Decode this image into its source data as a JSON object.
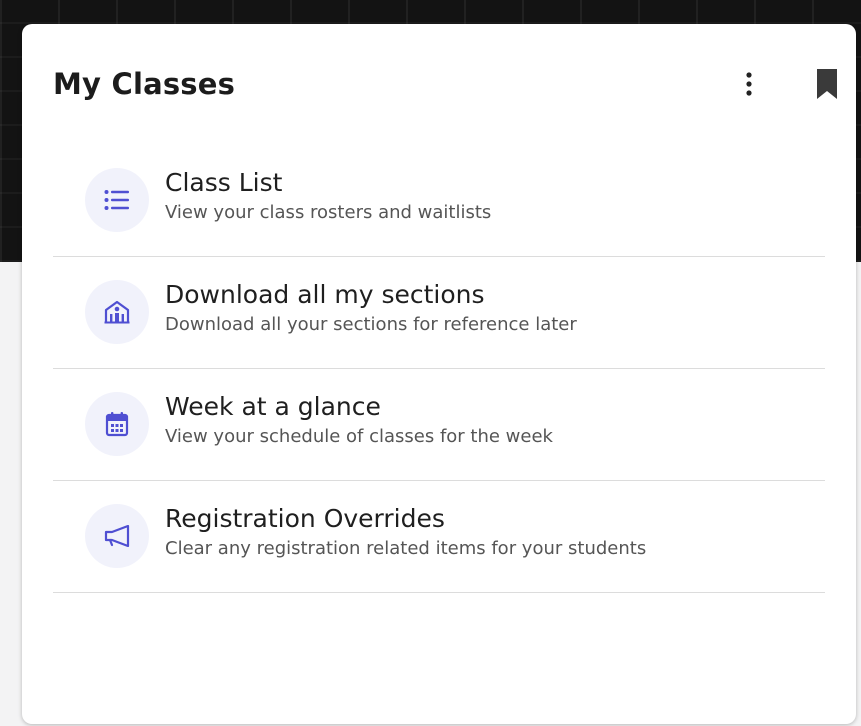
{
  "card": {
    "title": "My Classes",
    "menu_icon": "more-vertical-icon",
    "bookmark_icon": "bookmark-icon"
  },
  "items": [
    {
      "title": "Class List",
      "description": "View your class rosters and waitlists",
      "icon": "list-icon"
    },
    {
      "title": "Download all my sections",
      "description": "Download all your sections for reference later",
      "icon": "school-building-icon"
    },
    {
      "title": "Week at a glance",
      "description": "View your schedule of classes for the week",
      "icon": "calendar-icon"
    },
    {
      "title": "Registration Overrides",
      "description": "Clear any registration related items for your students",
      "icon": "megaphone-icon"
    }
  ],
  "colors": {
    "accent": "#4f4fd2",
    "icon_bg": "#f1f2fb",
    "title_text": "#1c1c1c",
    "desc_text": "#555555",
    "divider": "#dcdcdc"
  }
}
